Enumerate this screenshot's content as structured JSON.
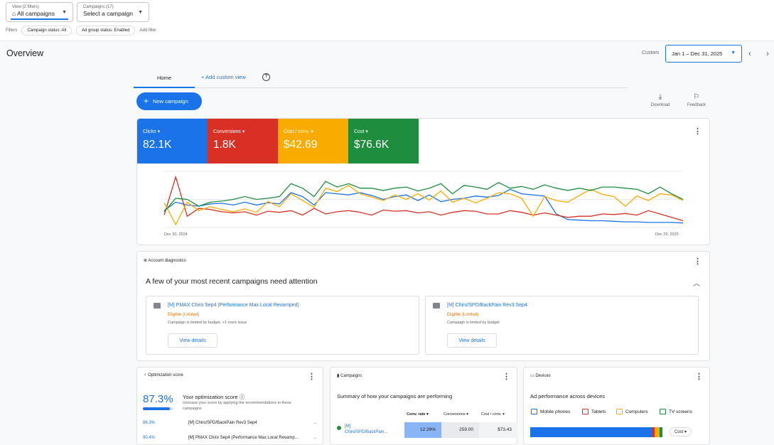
{
  "topbar": {
    "view_small": "View (2 filters)",
    "view_label": "All campaigns",
    "campaigns_small": "Campaigns (17)",
    "campaigns_label": "Select a campaign",
    "filters_label": "Filters",
    "chips": [
      "Campaign status: All",
      "Ad group status: Enabled"
    ],
    "add_filter": "Add filter"
  },
  "page_title": "Overview",
  "date": {
    "custom_label": "Custom",
    "range": "Jan 1 – Dec 31, 2025"
  },
  "tabs": {
    "home": "Home",
    "add_view": "+ Add custom view"
  },
  "new_campaign": "New campaign",
  "tools": {
    "download": "Download",
    "feedback": "Feedback"
  },
  "metrics": [
    {
      "label": "Clicks",
      "value": "82.1K",
      "color": "#1a73e8"
    },
    {
      "label": "Conversions",
      "value": "1.8K",
      "color": "#d93025"
    },
    {
      "label": "Cost / conv.",
      "value": "$42.69",
      "color": "#f9ab00"
    },
    {
      "label": "Cost",
      "value": "$76.6K",
      "color": "#1e8e3e"
    }
  ],
  "chart_data": {
    "type": "line",
    "x_start_label": "Dec 30, 2024",
    "x_end_label": "Dec 29, 2025",
    "grid": true,
    "series": [
      {
        "name": "Clicks",
        "color": "#1a73e8",
        "values": [
          30,
          45,
          40,
          38,
          42,
          43,
          40,
          45,
          40,
          44,
          42,
          62,
          55,
          40,
          62,
          60,
          58,
          62,
          57,
          50,
          55,
          58,
          48,
          58,
          46,
          50,
          52,
          56,
          54,
          57,
          68,
          60,
          58,
          56,
          24,
          14,
          13,
          12,
          12,
          11,
          10,
          10,
          9,
          9,
          9,
          8
        ]
      },
      {
        "name": "Conversions",
        "color": "#d93025",
        "values": [
          22,
          90,
          20,
          34,
          32,
          28,
          26,
          28,
          22,
          29,
          27,
          30,
          22,
          34,
          24,
          28,
          30,
          27,
          22,
          31,
          29,
          30,
          26,
          28,
          22,
          27,
          30,
          29,
          24,
          24,
          30,
          27,
          22,
          26,
          22,
          18,
          20,
          20,
          24,
          23,
          25,
          22,
          30,
          24,
          18,
          12
        ]
      },
      {
        "name": "Cost / conv.",
        "color": "#f9ab00",
        "values": [
          44,
          5,
          45,
          30,
          37,
          32,
          28,
          33,
          27,
          46,
          37,
          60,
          48,
          36,
          70,
          64,
          75,
          60,
          54,
          48,
          58,
          50,
          60,
          49,
          65,
          45,
          52,
          44,
          52,
          62,
          60,
          52,
          20,
          55,
          48,
          45,
          57,
          68,
          59,
          55,
          38,
          56,
          48,
          60,
          58,
          48
        ]
      },
      {
        "name": "Cost",
        "color": "#1e8e3e",
        "values": [
          28,
          52,
          50,
          38,
          45,
          47,
          50,
          55,
          50,
          52,
          55,
          78,
          70,
          55,
          82,
          72,
          78,
          70,
          70,
          66,
          70,
          72,
          65,
          70,
          78,
          60,
          75,
          72,
          68,
          80,
          70,
          73,
          68,
          76,
          70,
          66,
          70,
          66,
          72,
          72,
          70,
          68,
          60,
          72,
          60,
          50
        ]
      }
    ]
  },
  "diagnostics": {
    "header": "Account diagnostics",
    "title": "A few of your most recent campaigns need attention",
    "cards": [
      {
        "title": "[M] PMAX Chiro Sep4 (Performance Max Local Revamped)",
        "status": "Eligible (Limited)",
        "desc": "Campaign is limited by budget, +1 more issue",
        "button": "View details"
      },
      {
        "title": "[M] Chiro/SPD/BackPain Rev3 Sep4",
        "status": "Eligible (Limited)",
        "desc": "Campaign is limited by budget",
        "button": "View details"
      }
    ]
  },
  "optimization": {
    "header": "Optimization score",
    "score": "87.3%",
    "score_fraction": 0.873,
    "title": "Your optimization score",
    "desc": "Increase your score by applying the recommendations in these campaigns",
    "rows": [
      {
        "pct": "86.3%",
        "name": "[M] Chiro/SPD/BackPain Rev3 Sep4"
      },
      {
        "pct": "90.4%",
        "name": "[M] PMAX Chiro Sep4 (Performance Max Local Revamp..."
      }
    ]
  },
  "campaigns_card": {
    "header": "Campaigns",
    "title": "Summary of how your campaigns are performing",
    "columns": [
      "Conv. rate",
      "Conversions",
      "Cost / conv."
    ],
    "row": {
      "name_line1": "[M]",
      "name_line2": "Chiro/SPD/BackPain...",
      "conv_rate": "12.39%",
      "conversions": "259.00",
      "cost_conv": "$73.43"
    }
  },
  "devices": {
    "header": "Devices",
    "title": "Ad performance across devices",
    "legend": [
      {
        "label": "Mobile phones",
        "color": "#1a73e8"
      },
      {
        "label": "Tablets",
        "color": "#d93025"
      },
      {
        "label": "Computers",
        "color": "#f9ab00"
      },
      {
        "label": "TV screens",
        "color": "#1e8e3e"
      }
    ],
    "metric_select": "Cost",
    "shares": [
      0.9,
      0.02,
      0.04,
      0.02
    ]
  }
}
